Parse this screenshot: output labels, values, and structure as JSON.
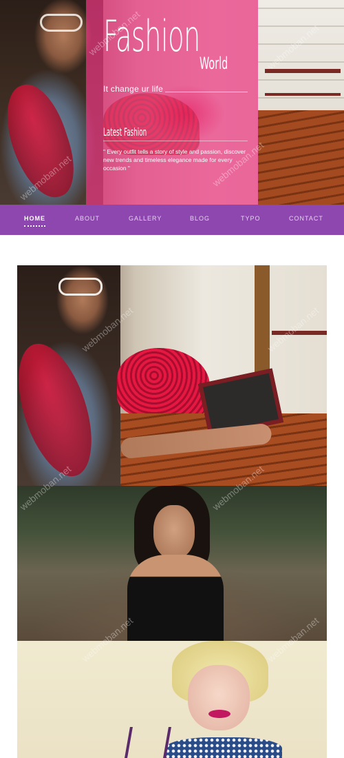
{
  "hero": {
    "brand_main": "Fashion",
    "brand_sub": "World",
    "tagline": "It change ur life",
    "latest_title": "Latest Fashion",
    "latest_text": "\" Every outfit tells a story of style and passion, discover new trends and timeless elegance made for every occasion \""
  },
  "nav": {
    "items": [
      {
        "label": "HOME"
      },
      {
        "label": "ABOUT"
      },
      {
        "label": "GALLERY"
      },
      {
        "label": "BLOG"
      },
      {
        "label": "TYPO"
      },
      {
        "label": "CONTACT"
      }
    ],
    "active_index": 0
  },
  "watermark": "webmoban.net",
  "colors": {
    "nav_bg": "#8f47b0",
    "hero_overlay": "#ec3782"
  }
}
